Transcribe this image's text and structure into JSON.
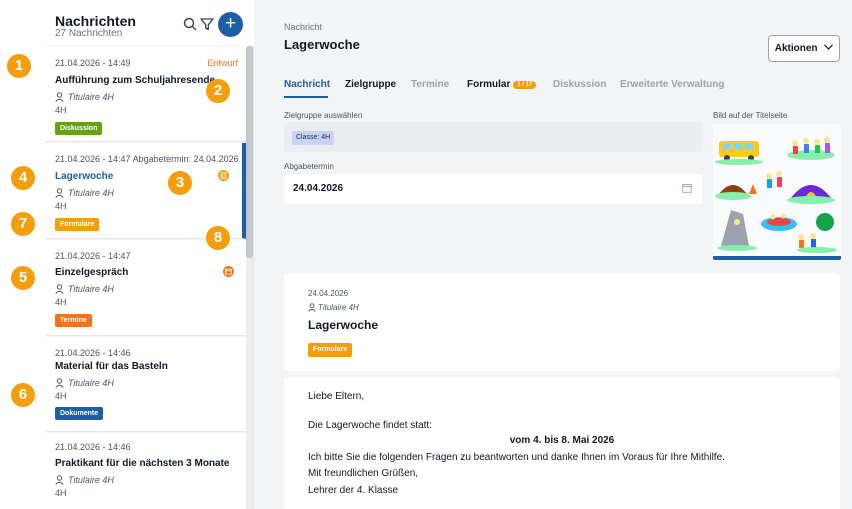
{
  "colors": {
    "accent": "#1d5fa6",
    "orange": "#f59e0b",
    "draft": "#f97316",
    "tag_discussion": "#65a30d",
    "tag_forms": "#f59e0b",
    "tag_appointments": "#f97316",
    "tag_documents": "#1d5fa6"
  },
  "sidebar": {
    "title": "Nachrichten",
    "count": "27 Nachrichten",
    "icons": [
      "search-icon",
      "filter-icon",
      "plus-icon"
    ],
    "messages": [
      {
        "date": "21.04.2026 - 14:49",
        "status": "Entwurf",
        "title": "Aufführung zum Schuljahresende",
        "author": "Titulaire 4H",
        "class": "4H",
        "tag": "Diskussion"
      },
      {
        "date": "21.04.2026 - 14:47  Abgabetermin: 24.04.2026",
        "title": "Lagerwoche",
        "author": "Titulaire 4H",
        "class": "4H",
        "tag": "Formulare",
        "icon": "form-icon"
      },
      {
        "date": "21.04.2026 - 14:47",
        "title": "Einzelgespräch",
        "author": "Titulaire 4H",
        "class": "4H",
        "tag": "Termine",
        "icon": "calendar-icon"
      },
      {
        "date": "21.04.2026 - 14:46",
        "title": "Material für das Basteln",
        "author": "Titulaire 4H",
        "class": "4H",
        "tag": "Dokumente"
      },
      {
        "date": "21.04.2026 - 14:46",
        "title": "Praktikant für die nächsten 3 Monate",
        "author": "Titulaire 4H",
        "class": "4H"
      }
    ]
  },
  "annotations": [
    "1",
    "2",
    "3",
    "4",
    "5",
    "6",
    "7",
    "8"
  ],
  "main": {
    "breadcrumb": "Nachricht",
    "title": "Lagerwoche",
    "actions_label": "Aktionen",
    "tabs": [
      {
        "label": "Nachricht"
      },
      {
        "label": "Zielgruppe"
      },
      {
        "label": "Termine"
      },
      {
        "label": "Formular",
        "badge": "1 / 17"
      },
      {
        "label": "Diskussion"
      },
      {
        "label": "Erweiterte Verwaltung"
      }
    ],
    "target_label": "Zielgruppe auswählen",
    "target_chip": "Classe: 4H",
    "due_label": "Abgabetermin",
    "due_value": "24.04.2026",
    "image_label": "Bild auf der Titelseite",
    "preview": {
      "date": "24.04.2026",
      "author": "Titulaire 4H",
      "title": "Lagerwoche",
      "tag": "Formulare"
    },
    "body": [
      "Liebe Eltern,",
      "Die Lagerwoche findet statt:",
      "vom 4. bis 8. Mai 2026",
      "Ich bitte Sie die folgenden Fragen zu beantworten und danke Ihnen im Voraus für Ihre Mithilfe.",
      "Mit freundlichen Grüßen,",
      "Lehrer der 4. Klasse"
    ]
  }
}
